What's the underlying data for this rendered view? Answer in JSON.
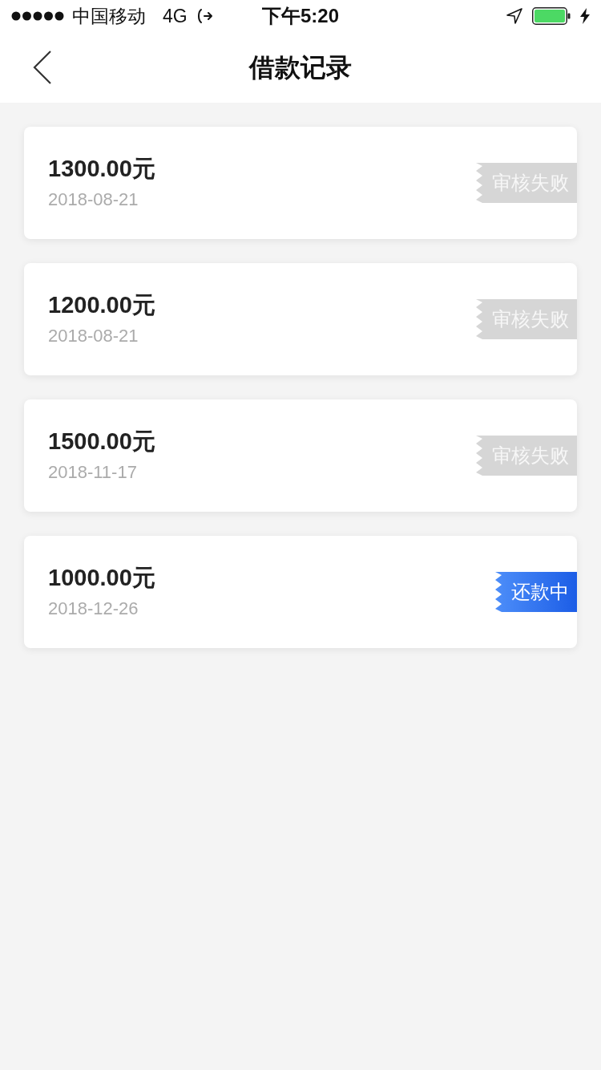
{
  "status_bar": {
    "carrier": "中国移动",
    "network": "4G",
    "time": "下午5:20"
  },
  "nav_bar": {
    "title": "借款记录"
  },
  "loans": [
    {
      "amount": "1300.00元",
      "date": "2018-08-21",
      "status": {
        "label": "审核失败",
        "kind": "failed"
      }
    },
    {
      "amount": "1200.00元",
      "date": "2018-08-21",
      "status": {
        "label": "审核失败",
        "kind": "failed"
      }
    },
    {
      "amount": "1500.00元",
      "date": "2018-11-17",
      "status": {
        "label": "审核失败",
        "kind": "failed"
      }
    },
    {
      "amount": "1000.00元",
      "date": "2018-12-26",
      "status": {
        "label": "还款中",
        "kind": "repaying"
      }
    }
  ]
}
